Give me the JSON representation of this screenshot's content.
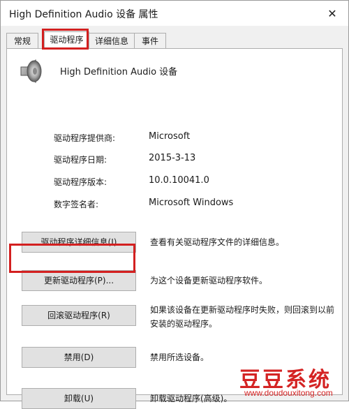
{
  "window": {
    "title": "High Definition Audio 设备 属性",
    "close_glyph": "✕"
  },
  "tabs": [
    {
      "label": "常规",
      "active": false
    },
    {
      "label": "驱动程序",
      "active": true
    },
    {
      "label": "详细信息",
      "active": false
    },
    {
      "label": "事件",
      "active": false
    }
  ],
  "device": {
    "name": "High Definition Audio 设备",
    "icon": "speaker-icon"
  },
  "driver_info": [
    {
      "label": "驱动程序提供商:",
      "value": "Microsoft"
    },
    {
      "label": "驱动程序日期:",
      "value": "2015-3-13"
    },
    {
      "label": "驱动程序版本:",
      "value": "10.0.10041.0"
    },
    {
      "label": "数字签名者:",
      "value": "Microsoft Windows"
    }
  ],
  "actions": [
    {
      "button": "驱动程序详细信息(I)",
      "description": "查看有关驱动程序文件的详细信息。"
    },
    {
      "button": "更新驱动程序(P)...",
      "description": "为这个设备更新驱动程序软件。"
    },
    {
      "button": "回滚驱动程序(R)",
      "description": "如果该设备在更新驱动程序时失败，则回滚到以前安装的驱动程序。"
    },
    {
      "button": "禁用(D)",
      "description": "禁用所选设备。"
    },
    {
      "button": "卸载(U)",
      "description": "卸载驱动程序(高级)。"
    }
  ],
  "highlight_color": "#d32020",
  "watermark": {
    "title": "豆豆系统",
    "url": "www.doudouxitong.com"
  }
}
